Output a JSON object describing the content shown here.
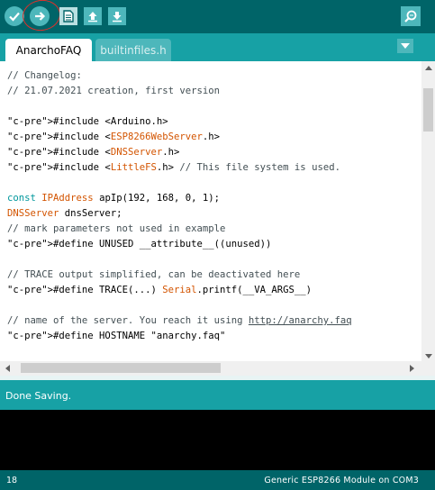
{
  "toolbar": {
    "buttons": [
      {
        "name": "verify-button",
        "icon": "checkmark-icon"
      },
      {
        "name": "upload-button",
        "icon": "arrow-right-icon"
      },
      {
        "name": "new-button",
        "icon": "new-file-icon"
      },
      {
        "name": "open-button",
        "icon": "arrow-up-icon"
      },
      {
        "name": "save-button",
        "icon": "arrow-down-icon"
      }
    ],
    "serial_monitor_icon": "magnifier-icon",
    "annotation_color": "#e0302a"
  },
  "tabs": [
    {
      "label": "AnarchoFAQ",
      "active": true
    },
    {
      "label": "builtinfiles.h",
      "active": false
    }
  ],
  "editor": {
    "lines": [
      {
        "text": "// Changelog:",
        "cls": "c-comment"
      },
      {
        "text": "// 21.07.2021 creation, first version",
        "cls": "c-comment"
      },
      {
        "text": "",
        "cls": ""
      },
      {
        "text": "#include <Arduino.h>",
        "cls": "c-pre"
      },
      {
        "text": "#include <ESP8266WebServer.h>",
        "cls": "c-pre"
      },
      {
        "text": "#include <DNSServer.h>",
        "cls": "c-pre"
      },
      {
        "text": "#include <LittleFS.h> // This file system is used.",
        "cls": "c-pre"
      },
      {
        "text": "",
        "cls": ""
      },
      {
        "text": "const IPAddress apIp(192, 168, 0, 1);",
        "cls": ""
      },
      {
        "text": "DNSServer dnsServer;",
        "cls": ""
      },
      {
        "text": "// mark parameters not used in example",
        "cls": "c-comment"
      },
      {
        "text": "#define UNUSED __attribute__((unused))",
        "cls": "c-pre"
      },
      {
        "text": "",
        "cls": ""
      },
      {
        "text": "// TRACE output simplified, can be deactivated here",
        "cls": "c-comment"
      },
      {
        "text": "#define TRACE(...) Serial.printf(__VA_ARGS__)",
        "cls": "c-pre"
      },
      {
        "text": "",
        "cls": ""
      },
      {
        "text": "// name of the server. You reach it using http://anarchy.faq",
        "cls": "c-comment"
      },
      {
        "text": "#define HOSTNAME \"anarchy.faq\"",
        "cls": "c-pre"
      }
    ]
  },
  "status": {
    "message": "Done Saving."
  },
  "footer": {
    "line_number": "18",
    "board": "Generic ESP8266 Module on COM3"
  },
  "colors": {
    "toolbar_bg": "#006468",
    "tab_strip_bg": "#17a1a5",
    "button_bg": "#4db7bb",
    "console_bg": "#000000"
  }
}
